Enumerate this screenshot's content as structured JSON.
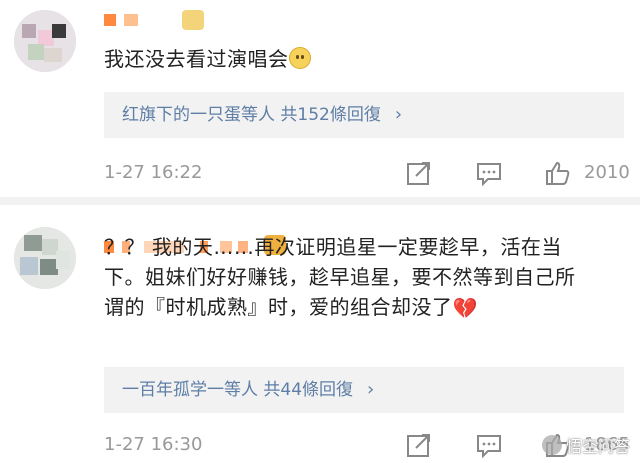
{
  "comments": [
    {
      "text": "我还没去看过演唱会",
      "emoji_icon": "smile-emoji-icon",
      "replies_summary": "红旗下的一只蛋等人 共152條回復",
      "time": "1-27 16:22",
      "likes": "2010"
    },
    {
      "text_line1": "？？ 我的天……再次证明追星一定要趁早，活在当",
      "text_line2": "下。姐妹们好好赚钱，趁早追星，要不然等到自己所",
      "text_line3": "谓的『时机成熟』时，爱的组合却没了",
      "emoji_icon": "broken-heart-icon",
      "replies_summary": "一百年孤学一等人 共44條回復",
      "time": "1-27 16:30",
      "likes": "1865"
    }
  ],
  "watermark": {
    "text": "悟空问答"
  },
  "colors": {
    "link": "#5e7ea6",
    "meta": "#999999",
    "reply_bg": "#f2f2f2"
  }
}
